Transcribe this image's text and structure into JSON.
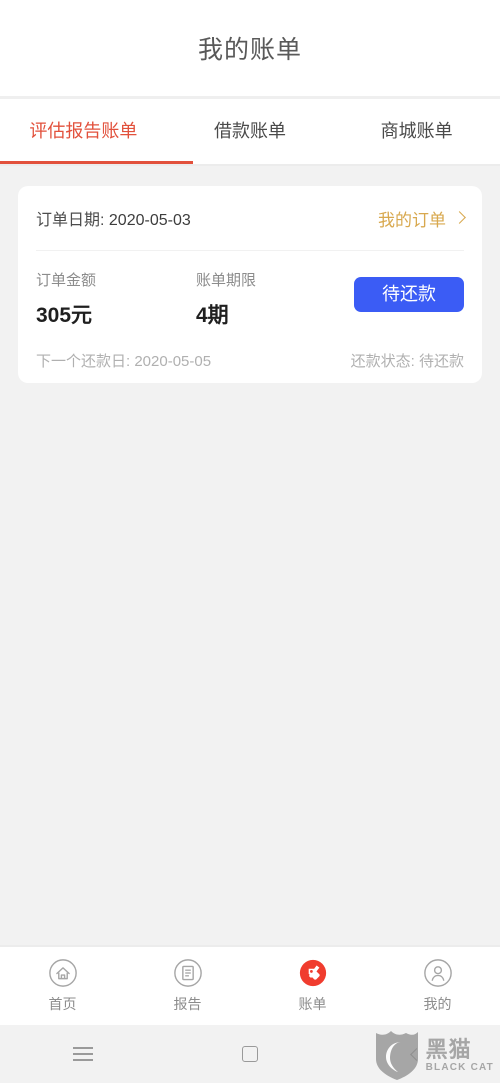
{
  "header": {
    "title": "我的账单"
  },
  "tabs": [
    {
      "label": "评估报告账单",
      "active": true
    },
    {
      "label": "借款账单",
      "active": false
    },
    {
      "label": "商城账单",
      "active": false
    }
  ],
  "card": {
    "order_date_label": "订单日期:",
    "order_date_value": "2020-05-03",
    "my_orders_label": "我的订单",
    "amount_label": "订单金额",
    "amount_value": "305元",
    "term_label": "账单期限",
    "term_value": "4期",
    "status_button": "待还款",
    "next_repay_label": "下一个还款日:",
    "next_repay_value": "2020-05-05",
    "repay_status_label": "还款状态:",
    "repay_status_value": "待还款"
  },
  "bottom_nav": [
    {
      "label": "首页",
      "icon": "home-icon",
      "active": false
    },
    {
      "label": "报告",
      "icon": "report-icon",
      "active": false
    },
    {
      "label": "账单",
      "icon": "bill-tag-icon",
      "active": true
    },
    {
      "label": "我的",
      "icon": "profile-icon",
      "active": false
    }
  ],
  "system_bar": [
    {
      "icon": "menu-icon"
    },
    {
      "icon": "home-square-icon"
    },
    {
      "icon": "back-icon"
    }
  ],
  "watermark": {
    "cn": "黑猫",
    "en": "BLACK CAT"
  },
  "colors": {
    "accent_red": "#e2513c",
    "gold": "#d8a84e",
    "button_blue": "#3b5cf5",
    "bill_icon_red": "#f03c2e",
    "page_background": "#f2f2f2"
  }
}
